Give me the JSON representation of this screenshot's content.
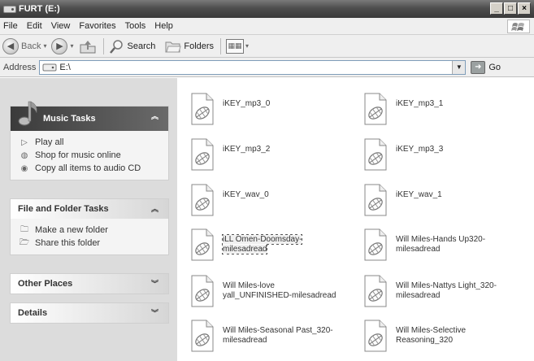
{
  "window": {
    "title": "FURT (E:)",
    "controls": [
      "_",
      "□",
      "×"
    ]
  },
  "menu": [
    "File",
    "Edit",
    "View",
    "Favorites",
    "Tools",
    "Help"
  ],
  "toolbar": {
    "back": "Back",
    "search": "Search",
    "folders": "Folders"
  },
  "address": {
    "label": "Address",
    "value": "E:\\",
    "go": "Go"
  },
  "sidebar": {
    "music_tasks": {
      "title": "Music Tasks",
      "items": [
        "Play all",
        "Shop for music online",
        "Copy all items to audio CD"
      ]
    },
    "file_folder_tasks": {
      "title": "File and Folder Tasks",
      "items": [
        "Make a new folder",
        "Share this folder"
      ]
    },
    "other_places": {
      "title": "Other Places"
    },
    "details": {
      "title": "Details"
    }
  },
  "files": [
    {
      "name": "iKEY_mp3_0"
    },
    {
      "name": "iKEY_mp3_1"
    },
    {
      "name": "iKEY_mp3_2"
    },
    {
      "name": "iKEY_mp3_3"
    },
    {
      "name": "iKEY_wav_0"
    },
    {
      "name": "iKEY_wav_1"
    },
    {
      "name": "iLL Omen-Doomsday-milesadread",
      "selected": true
    },
    {
      "name": "Will Miles-Hands Up320-milesadread"
    },
    {
      "name": "Will Miles-love yall_UNFINISHED-milesadread"
    },
    {
      "name": "Will Miles-Nattys Light_320-milesadread"
    },
    {
      "name": "Will Miles-Seasonal Past_320-milesadread"
    },
    {
      "name": "Will Miles-Selective Reasoning_320"
    }
  ]
}
